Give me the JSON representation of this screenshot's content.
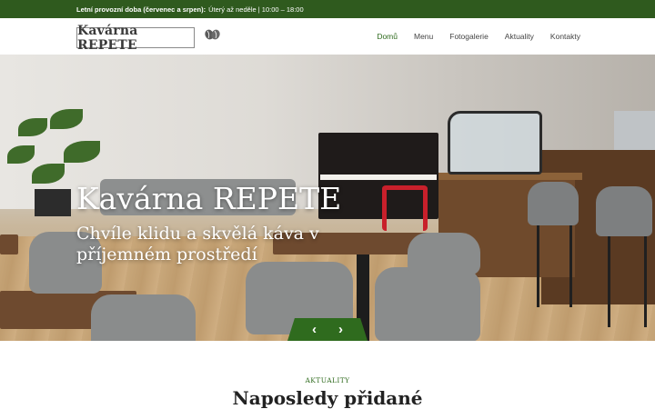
{
  "topbar": {
    "label": "Letní provozní doba (červenec a srpen):",
    "hours": "Úterý až neděle | 10:00 – 18:00"
  },
  "header": {
    "logo_text": "Kavárna REPETE",
    "nav": [
      {
        "label": "Domů",
        "active": true
      },
      {
        "label": "Menu"
      },
      {
        "label": "Fotogalerie"
      },
      {
        "label": "Aktuality"
      },
      {
        "label": "Kontakty"
      }
    ]
  },
  "hero": {
    "title": "Kavárna REPETE",
    "subtitle": "Chvíle klidu a skvělá káva v příjemném prostředí",
    "prev_icon": "‹",
    "next_icon": "›"
  },
  "news": {
    "label": "AKTUALITY",
    "title": "Naposledy přidané"
  },
  "colors": {
    "brand_green": "#2f6b1e",
    "topbar_green": "#2f5a1e"
  }
}
